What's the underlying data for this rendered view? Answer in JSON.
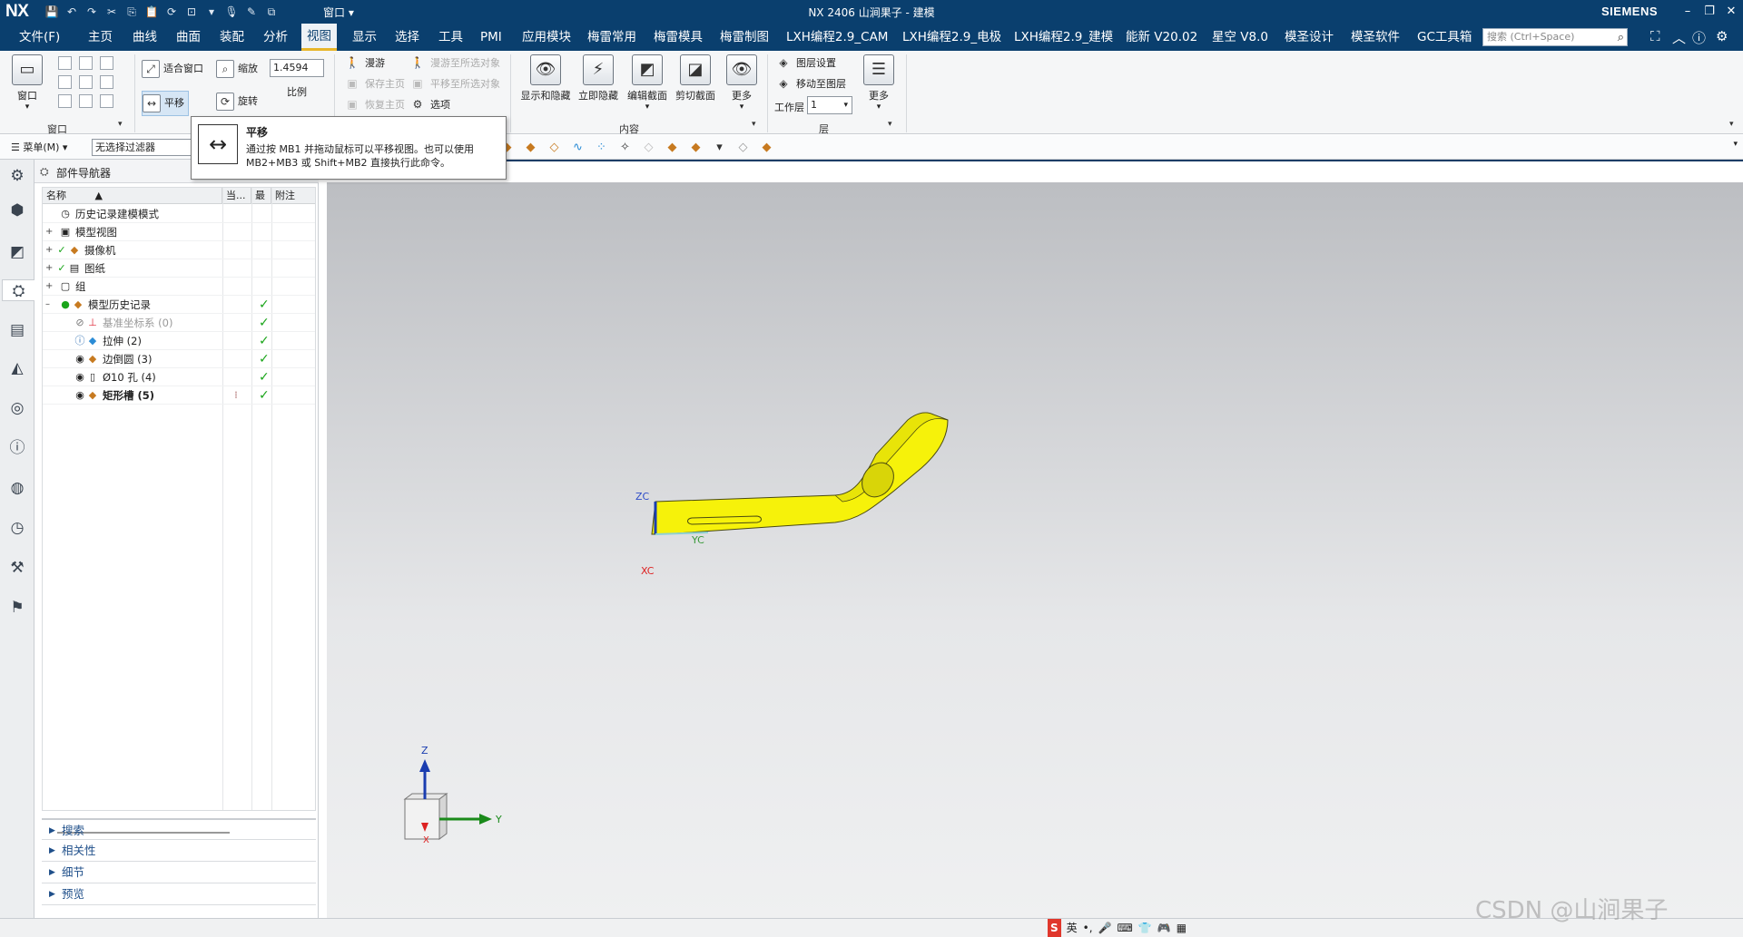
{
  "titlebar": {
    "logo": "NX",
    "window_menu": "窗口",
    "title": "NX 2406 山涧果子 - 建模",
    "brand": "SIEMENS",
    "controls": [
      "–",
      "❐",
      "✕"
    ]
  },
  "menubar": {
    "items": [
      "文件(F)",
      "主页",
      "曲线",
      "曲面",
      "装配",
      "分析",
      "视图",
      "显示",
      "选择",
      "工具",
      "PMI",
      "应用模块",
      "梅雷常用",
      "梅雷模具",
      "梅雷制图",
      "LXH编程2.9_CAM",
      "LXH编程2.9_电极",
      "LXH编程2.9_建模",
      "能新 V20.02",
      "星空 V8.0",
      "模圣设计",
      "模圣软件",
      "GC工具箱"
    ],
    "active": "视图",
    "search_placeholder": "搜索 (Ctrl+Space)"
  },
  "ribbon": {
    "window_group": {
      "label": "窗口",
      "button": "窗口"
    },
    "orient": {
      "fit": "适合窗口",
      "zoom": "缩放",
      "scale_value": "1.4594",
      "scale_label": "比例",
      "pan": "平移",
      "rotate": "旋转"
    },
    "nav": {
      "walk": "漫游",
      "save_main": "保存主页",
      "restore_main": "恢复主页",
      "walk_to": "漫游至所选对象",
      "pan_to": "平移至所选对象",
      "options": "选项"
    },
    "content": {
      "label": "内容",
      "show_hide": "显示和隐藏",
      "instant_hide": "立即隐藏",
      "edit_section": "编辑截面",
      "clip_section": "剪切截面",
      "more": "更多"
    },
    "layer": {
      "label": "层",
      "settings": "图层设置",
      "move_to": "移动至图层",
      "work_layer_label": "工作层",
      "work_layer_value": "1",
      "more": "更多"
    }
  },
  "tooltip": {
    "title": "平移",
    "description": "通过按 MB1 并拖动鼠标可以平移视图。也可以使用 MB2+MB3 或 Shift+MB2 直接执行此命令。"
  },
  "filterbar": {
    "menu": "菜单(M)",
    "filter": "无选择过滤器"
  },
  "navigator": {
    "title": "部件导航器",
    "columns": {
      "name": "名称",
      "current": "当...",
      "latest": "最",
      "notes": "附注"
    },
    "rows": [
      {
        "label": "历史记录建模模式",
        "exp": "",
        "checked": false
      },
      {
        "label": "模型视图",
        "exp": "+",
        "checked": false
      },
      {
        "label": "摄像机",
        "exp": "+",
        "checked": false
      },
      {
        "label": "图纸",
        "exp": "+",
        "checked": false
      },
      {
        "label": "组",
        "exp": "+",
        "checked": false
      },
      {
        "label": "模型历史记录",
        "exp": "–",
        "checked": true
      },
      {
        "label": "基准坐标系 (0)",
        "exp": "",
        "checked": true
      },
      {
        "label": "拉伸 (2)",
        "exp": "",
        "checked": true
      },
      {
        "label": "边倒圆 (3)",
        "exp": "",
        "checked": true
      },
      {
        "label": "Ø10 孔 (4)",
        "exp": "",
        "checked": true
      },
      {
        "label": "矩形槽 (5)",
        "exp": "",
        "checked": true
      }
    ],
    "sections": [
      "搜索",
      "相关性",
      "细节",
      "预览"
    ]
  },
  "viewport": {
    "part_axes": {
      "zc": "ZC",
      "yc": "YC",
      "xc": "XC"
    },
    "triad": {
      "z": "Z",
      "y": "Y",
      "x": "X"
    },
    "part_color": "#f6f20a"
  },
  "statusbar": {
    "ime": [
      "英",
      "•,",
      "🎤",
      "⌨",
      "👕",
      "🎮",
      "▦"
    ]
  },
  "watermark": "CSDN @山涧果子"
}
